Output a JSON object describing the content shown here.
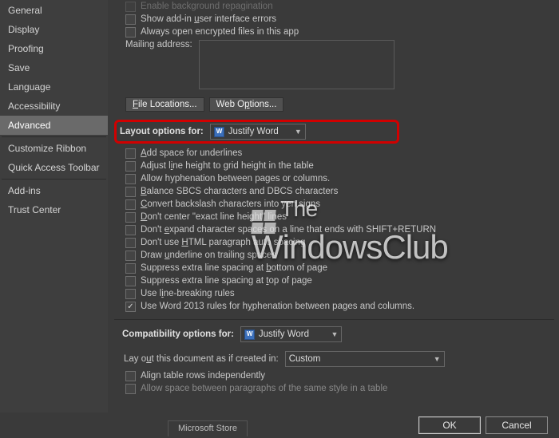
{
  "sidebar": {
    "items": [
      {
        "label": "General"
      },
      {
        "label": "Display"
      },
      {
        "label": "Proofing"
      },
      {
        "label": "Save"
      },
      {
        "label": "Language"
      },
      {
        "label": "Accessibility"
      },
      {
        "label": "Advanced",
        "selected": true
      },
      {
        "label": "Customize Ribbon"
      },
      {
        "label": "Quick Access Toolbar"
      },
      {
        "label": "Add-ins"
      },
      {
        "label": "Trust Center"
      }
    ]
  },
  "general_opts": {
    "enable_bg": "Enable background repagination",
    "show_addin": "Show add-in user interface errors",
    "always_open": "Always open encrypted files in this app",
    "mailing_label": "Mailing address:"
  },
  "btns": {
    "file_loc": "File Locations...",
    "web_opt": "Web Options..."
  },
  "layout_header": {
    "label": "Layout options for:",
    "combo": "Justify Word"
  },
  "layout_opts": [
    {
      "u": "A",
      "t": "dd space for underlines",
      "checked": false
    },
    {
      "u": "",
      "t": "Adjust line height to grid height in the table",
      "checked": false,
      "pre_u": "",
      "underline_at": 7,
      "raw": "Adjust line height to grid height in the table"
    },
    {
      "u": "",
      "t": "Allow hyphenation between pages or columns.",
      "checked": false
    },
    {
      "u": "",
      "t": "Balance SBCS characters and DBCS characters",
      "checked": false
    },
    {
      "u": "",
      "t": "Convert backslash characters into yen signs",
      "checked": false
    },
    {
      "u": "",
      "t": "Don't center \"exact line height\" lines",
      "checked": false
    },
    {
      "u": "",
      "t": "Don't expand character spaces on a line that ends with SHIFT+RETURN",
      "checked": false
    },
    {
      "u": "",
      "t": "Don't use HTML paragraph auto spacing",
      "checked": false
    },
    {
      "u": "",
      "t": "Draw underline on trailing spaces",
      "checked": false
    },
    {
      "u": "",
      "t": "Suppress extra line spacing at bottom of page",
      "checked": false
    },
    {
      "u": "",
      "t": "Suppress extra line spacing at top of page",
      "checked": false
    },
    {
      "u": "",
      "t": "Use line-breaking rules",
      "checked": false
    },
    {
      "u": "",
      "t": "Use Word 2013 rules for hyphenation between pages and columns.",
      "checked": true
    }
  ],
  "layout_html": [
    "<span class='underline'>A</span>dd space for underlines",
    "Adjust l<span class='underline'>i</span>ne height to grid height in the table",
    "Allow hyphenation between pages or columns.",
    "<span class='underline'>B</span>alance SBCS characters and DBCS characters",
    "<span class='underline'>C</span>onvert backslash characters into yen signs",
    "<span class='underline'>D</span>on't center \"exact line height\" lines",
    "Don't <span class='underline'>e</span>xpand character spaces on a line that ends with SHIFT+RETURN",
    "Don't use <span class='underline'>H</span>TML paragraph auto spacing",
    "Draw <span class='underline'>u</span>nderline on trailing spaces",
    "Suppress extra line spacing at <span class='underline'>b</span>ottom of page",
    "Suppress extra line spacing at <span class='underline'>t</span>op of page",
    "Use l<span class='underline'>i</span>ne-breaking rules",
    "Use Word 2013 rules for h<span class='underline'>y</span>phenation between pages and columns."
  ],
  "compat": {
    "header": "Compatibility options for:",
    "combo": "Justify Word",
    "layout_label": "Lay out this document as if created in:",
    "layout_combo": "Custom",
    "align": "Align table rows independently",
    "allow": "Allow space between paragraphs of the same style in a table"
  },
  "bottom": {
    "ok": "OK",
    "cancel": "Cancel",
    "ms": "Microsoft Store"
  },
  "watermark": {
    "line1": "The",
    "line2": "WindowsClub"
  }
}
